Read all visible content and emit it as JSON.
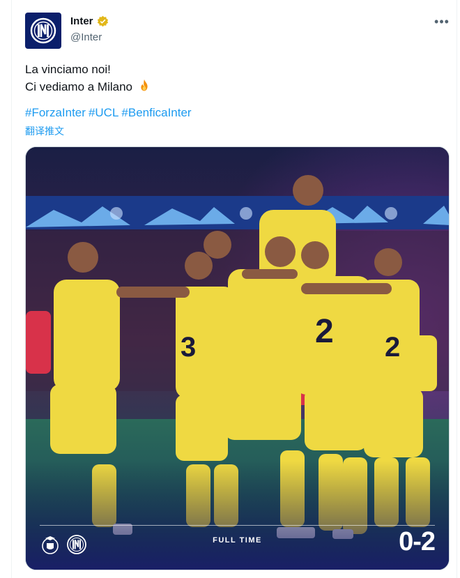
{
  "author": {
    "display_name": "Inter",
    "handle": "@Inter",
    "verified": true,
    "avatar_icon": "inter-logo-icon"
  },
  "more_icon": "more-horizontal-icon",
  "more_label": "•••",
  "tweet": {
    "lines": [
      "La vinciamo noi!",
      "Ci vediamo a Milano"
    ],
    "emoji": "fire",
    "hashtags": [
      "#ForzaInter",
      "#UCL",
      "#BenficaInter"
    ],
    "translate_label": "翻译推文"
  },
  "media": {
    "full_time_label": "FULL TIME",
    "score": "0-2",
    "crests": [
      "benfica-crest-icon",
      "inter-crest-icon"
    ]
  },
  "colors": {
    "link": "#1d9bf0",
    "inter_blue": "#0b1f6b",
    "kit_yellow": "#f2e04a",
    "verified_gold": "#e2b719"
  }
}
